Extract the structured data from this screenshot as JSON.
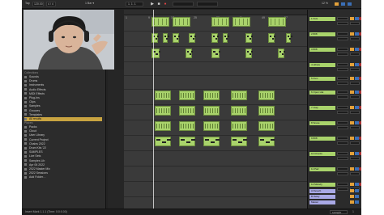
{
  "transport": {
    "tempo": "120.00",
    "signature": "4 / 4",
    "bar_menu": "1 Bar ▾",
    "position": "1. 1. 1",
    "cpu": "12 %",
    "play_icon": "play-icon",
    "stop_icon": "stop-icon",
    "record_icon": "record-icon"
  },
  "browser": {
    "collections_header": "Collections",
    "categories": [
      {
        "label": "Sounds"
      },
      {
        "label": "Drums"
      },
      {
        "label": "Instruments"
      },
      {
        "label": "Audio Effects"
      },
      {
        "label": "MIDI Effects"
      },
      {
        "label": "Plug-Ins"
      },
      {
        "label": "Clips"
      },
      {
        "label": "Samples"
      },
      {
        "label": "Grooves"
      },
      {
        "label": "Templates"
      },
      {
        "label": "All results"
      }
    ],
    "places_header": "Places",
    "places": [
      {
        "label": "Packs"
      },
      {
        "label": "Cloud"
      },
      {
        "label": "User Library"
      },
      {
        "label": "Current Project"
      },
      {
        "label": "Chains 2022"
      },
      {
        "label": "Drum Kits '22"
      },
      {
        "label": "SAMPLES"
      },
      {
        "label": "Live Sets"
      },
      {
        "label": "Samples Lib"
      },
      {
        "label": "Apr 06 2022"
      },
      {
        "label": "2022 Master Mix"
      },
      {
        "label": "2022 Sessions"
      },
      {
        "label": "Add Folder…"
      }
    ],
    "selected_index": 10
  },
  "tracks": [
    {
      "name": "1 Kick",
      "color": "#a9d36b"
    },
    {
      "name": "2 808",
      "color": "#a9d36b"
    },
    {
      "name": "3 808",
      "color": "#a9d36b"
    },
    {
      "name": "4 Hihats",
      "color": "#a9d36b"
    },
    {
      "name": "5 Perc",
      "color": "#a9d36b"
    },
    {
      "name": "6 Open Hat",
      "color": "#a9d36b"
    },
    {
      "name": "7 Clap",
      "color": "#a9d36b"
    },
    {
      "name": "8 Snare",
      "color": "#a9d36b"
    },
    {
      "name": "9 808",
      "color": "#a9d36b"
    },
    {
      "name": "10 Chords",
      "color": "#a9d36b"
    },
    {
      "name": "11 Pad",
      "color": "#a9d36b"
    },
    {
      "name": "12 Melody",
      "color": "#a9d36b"
    }
  ],
  "returns": [
    {
      "name": "A Reverb"
    },
    {
      "name": "B Delay"
    },
    {
      "name": "Master"
    }
  ],
  "mixer": {
    "send_label": "S",
    "arm_label": "A",
    "input_label": "All Ins",
    "monitor_label": "Auto",
    "volume_label": "0"
  },
  "ruler": {
    "marks": [
      "1",
      "9",
      "17",
      "25",
      "33",
      "41",
      "49",
      "57"
    ]
  },
  "status": {
    "left": "Insert Mark 1.1.1 (Time: 0:0:0.00)",
    "right_label": "sample",
    "track_count": "1"
  }
}
